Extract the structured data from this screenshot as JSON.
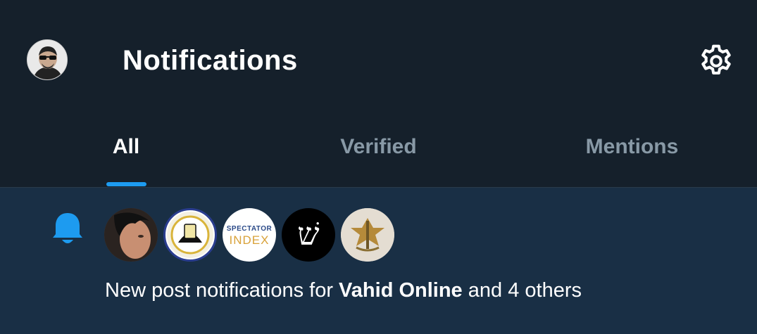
{
  "header": {
    "title": "Notifications",
    "icons": {
      "profile": "profile-avatar",
      "settings": "gear-icon"
    }
  },
  "tabs": [
    {
      "label": "All",
      "active": true
    },
    {
      "label": "Verified",
      "active": false
    },
    {
      "label": "Mentions",
      "active": false
    }
  ],
  "notification": {
    "icon": "bell-icon",
    "avatars": [
      {
        "name": "vahid-online-avatar"
      },
      {
        "name": "seal-avatar"
      },
      {
        "name": "spectator-index-avatar",
        "text_top": "SPECTATOR",
        "text_bottom": "INDEX"
      },
      {
        "name": "shin-avatar",
        "glyph": "שׁ"
      },
      {
        "name": "idf-emblem-avatar"
      }
    ],
    "prefix": "New post notifications for",
    "highlight": "Vahid Online",
    "suffix": "and 4 others"
  },
  "colors": {
    "background": "#15202b",
    "row_background": "#192f45",
    "accent": "#1d9bf0",
    "muted": "#8899a6",
    "text": "#ffffff"
  }
}
